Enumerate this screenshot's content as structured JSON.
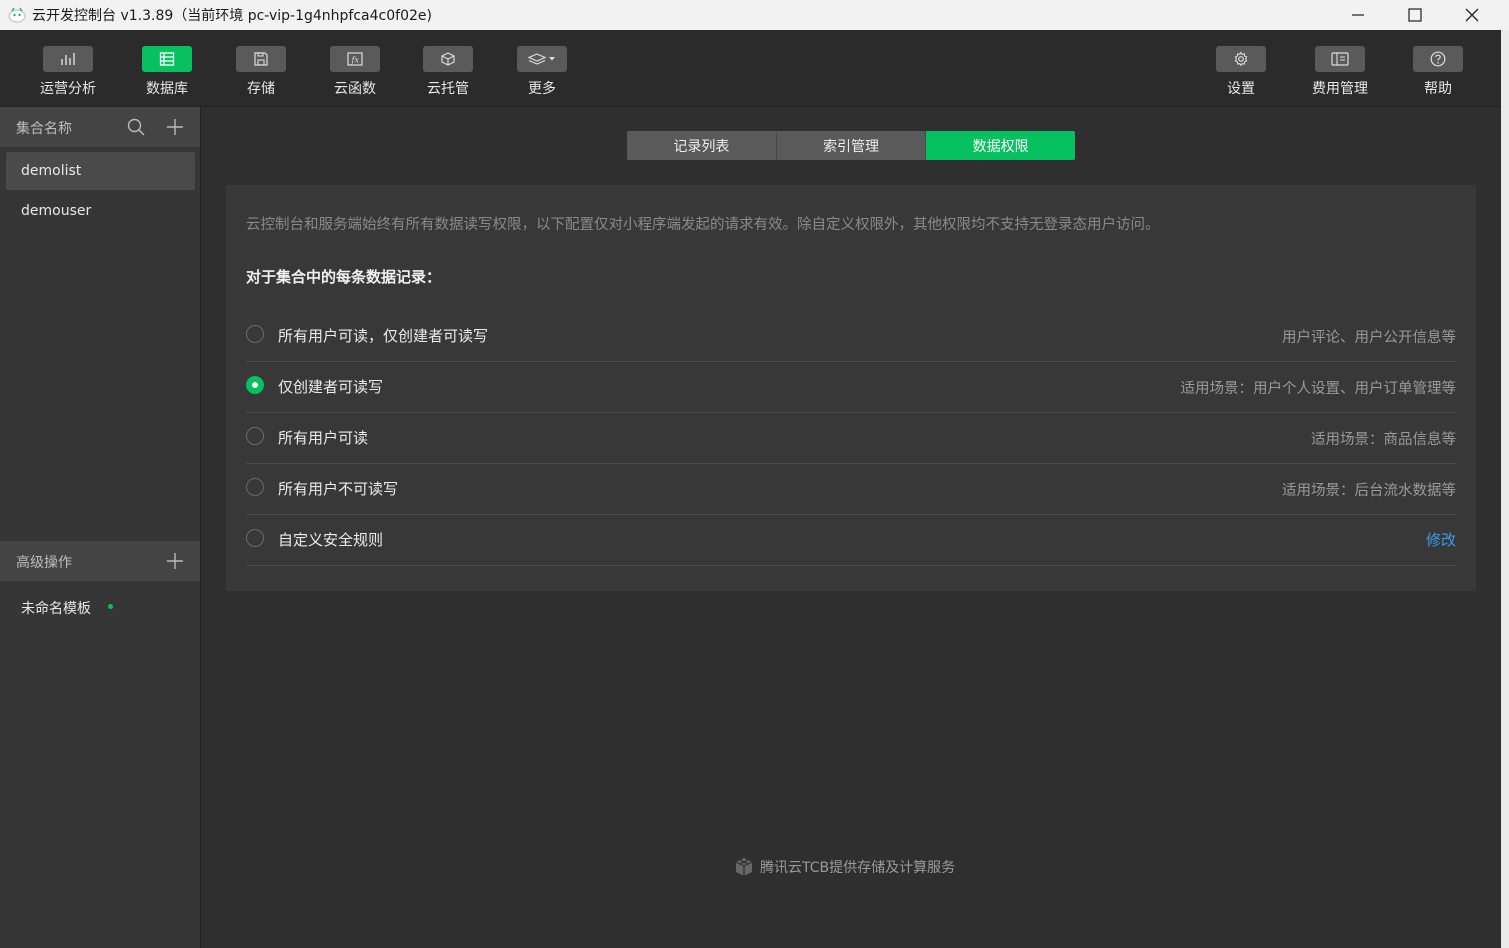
{
  "window": {
    "title": "云开发控制台 v1.3.89（当前环境 pc-vip-1g4nhpfca4c0f02e)"
  },
  "toolbar": {
    "left_tools": [
      {
        "label": "运营分析",
        "icon": "bar-chart-icon"
      },
      {
        "label": "数据库",
        "icon": "database-icon"
      },
      {
        "label": "存储",
        "icon": "save-icon"
      },
      {
        "label": "云函数",
        "icon": "function-icon"
      },
      {
        "label": "云托管",
        "icon": "box-icon"
      },
      {
        "label": "更多",
        "icon": "layers-icon"
      }
    ],
    "right_tools": [
      {
        "label": "设置",
        "icon": "gear-icon"
      },
      {
        "label": "费用管理",
        "icon": "billing-icon"
      },
      {
        "label": "帮助",
        "icon": "help-icon"
      }
    ]
  },
  "sidebar": {
    "collections_header": "集合名称",
    "collections": [
      "demolist",
      "demouser"
    ],
    "advanced_header": "高级操作",
    "templates": [
      "未命名模板"
    ]
  },
  "tabs": [
    "记录列表",
    "索引管理",
    "数据权限"
  ],
  "permissions": {
    "notice": "云控制台和服务端始终有所有数据读写权限，以下配置仅对小程序端发起的请求有效。除自定义权限外，其他权限均不支持无登录态用户访问。",
    "subheading": "对于集合中的每条数据记录：",
    "options": [
      {
        "label": "所有用户可读，仅创建者可读写",
        "desc": "用户评论、用户公开信息等"
      },
      {
        "label": "仅创建者可读写",
        "desc": "适用场景：用户个人设置、用户订单管理等"
      },
      {
        "label": "所有用户可读",
        "desc": "适用场景：商品信息等"
      },
      {
        "label": "所有用户不可读写",
        "desc": "适用场景：后台流水数据等"
      },
      {
        "label": "自定义安全规则",
        "link": "修改"
      }
    ]
  },
  "footer": {
    "text": "腾讯云TCB提供存储及计算服务"
  },
  "colors": {
    "accent": "#07c160",
    "link": "#3a9bf0"
  }
}
